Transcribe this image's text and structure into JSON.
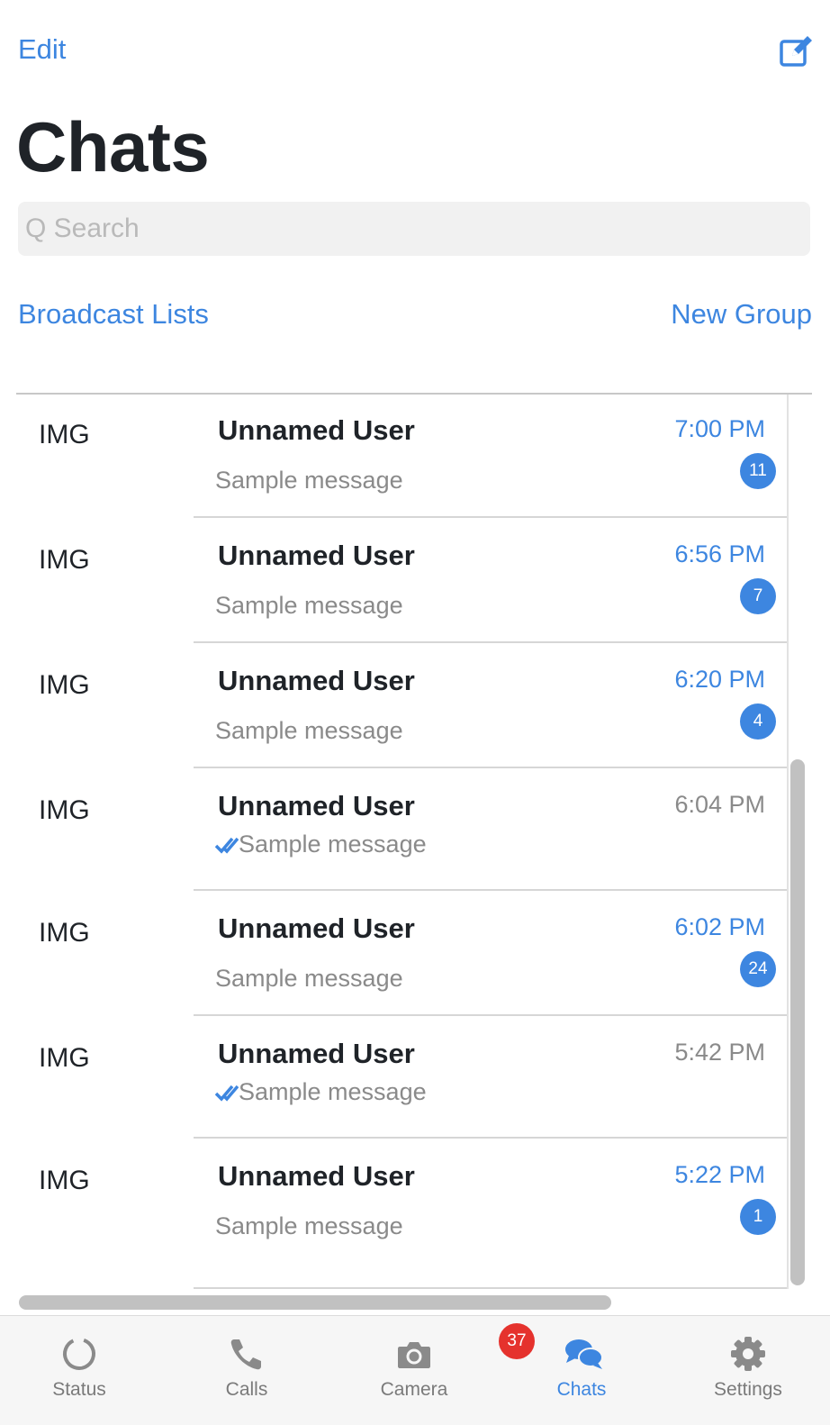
{
  "header": {
    "edit_label": "Edit",
    "compose_icon": "compose-icon",
    "title": "Chats"
  },
  "search": {
    "placeholder": "Q Search",
    "value": ""
  },
  "actions": {
    "broadcast_label": "Broadcast Lists",
    "new_group_label": "New Group"
  },
  "colors": {
    "accent": "#3d86e0",
    "badge_red": "#e5322d",
    "muted": "#8a8a8a"
  },
  "chats": [
    {
      "avatar": "IMG",
      "name": "Unnamed User",
      "message": "Sample message",
      "time": "7:00 PM",
      "unread": "11",
      "read_receipt": false
    },
    {
      "avatar": "IMG",
      "name": "Unnamed User",
      "message": "Sample message",
      "time": "6:56 PM",
      "unread": "7",
      "read_receipt": false
    },
    {
      "avatar": "IMG",
      "name": "Unnamed User",
      "message": "Sample message",
      "time": "6:20 PM",
      "unread": "4",
      "read_receipt": false
    },
    {
      "avatar": "IMG",
      "name": "Unnamed User",
      "message": "Sample message",
      "time": "6:04 PM",
      "unread": "",
      "read_receipt": true
    },
    {
      "avatar": "IMG",
      "name": "Unnamed User",
      "message": "Sample message",
      "time": "6:02 PM",
      "unread": "24",
      "read_receipt": false
    },
    {
      "avatar": "IMG",
      "name": "Unnamed User",
      "message": "Sample message",
      "time": "5:42 PM",
      "unread": "",
      "read_receipt": true
    },
    {
      "avatar": "IMG",
      "name": "Unnamed User",
      "message": "Sample message",
      "time": "5:22 PM",
      "unread": "1",
      "read_receipt": false
    }
  ],
  "tabbar": {
    "tabs": [
      {
        "label": "Status",
        "icon": "status-icon",
        "active": false
      },
      {
        "label": "Calls",
        "icon": "phone-icon",
        "active": false
      },
      {
        "label": "Camera",
        "icon": "camera-icon",
        "active": false
      },
      {
        "label": "Chats",
        "icon": "chats-icon",
        "active": true
      },
      {
        "label": "Settings",
        "icon": "gear-icon",
        "active": false
      }
    ],
    "chats_badge": "37"
  }
}
